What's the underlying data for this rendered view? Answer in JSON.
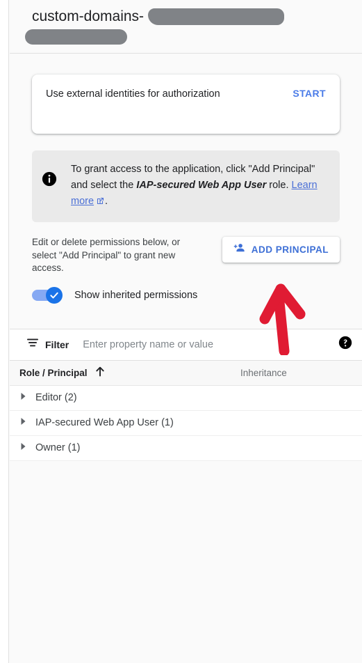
{
  "header": {
    "title": "custom-domains-",
    "redacted_badges": [
      "redacted-1",
      "redacted-2"
    ]
  },
  "external_identities_card": {
    "text": "Use external identities for authorization",
    "action_label": "START"
  },
  "info_box": {
    "icon": "info-icon",
    "text_part_1": "To grant access to the application, click \"Add Principal\" and select the ",
    "emphasis": "IAP-secured Web App User",
    "text_part_2": " role. ",
    "link_label": "Learn more",
    "link_icon": "external-link-icon",
    "text_part_3": "."
  },
  "permissions": {
    "description": "Edit or delete permissions below, or select \"Add Principal\" to grant new access.",
    "add_principal_label": "ADD PRINCIPAL",
    "add_principal_icon": "person-add-icon",
    "toggle_label": "Show inherited permissions",
    "toggle_state": "on"
  },
  "filter": {
    "icon": "filter-icon",
    "label": "Filter",
    "placeholder": "Enter property name or value",
    "value": "",
    "help_icon": "help-icon"
  },
  "table": {
    "columns": [
      {
        "label": "Role / Principal",
        "sort": "ascending",
        "sort_icon": "arrow-up-icon"
      },
      {
        "label": "Inheritance"
      }
    ],
    "rows": [
      {
        "label": "Editor (2)",
        "expanded": false,
        "caret": "caret-right-icon",
        "inheritance": ""
      },
      {
        "label": "IAP-secured Web App User (1)",
        "expanded": false,
        "caret": "caret-right-icon",
        "inheritance": ""
      },
      {
        "label": "Owner (1)",
        "expanded": false,
        "caret": "caret-right-icon",
        "inheritance": ""
      }
    ]
  },
  "annotation": {
    "arrow": "red-up-arrow-annotation",
    "color": "#e01b33"
  },
  "colors": {
    "accent_blue": "#1a73e8",
    "link_blue": "#4a6fd6",
    "annotation_red": "#e01b33",
    "redaction_gray": "#808387",
    "page_bg": "#fafafa"
  }
}
